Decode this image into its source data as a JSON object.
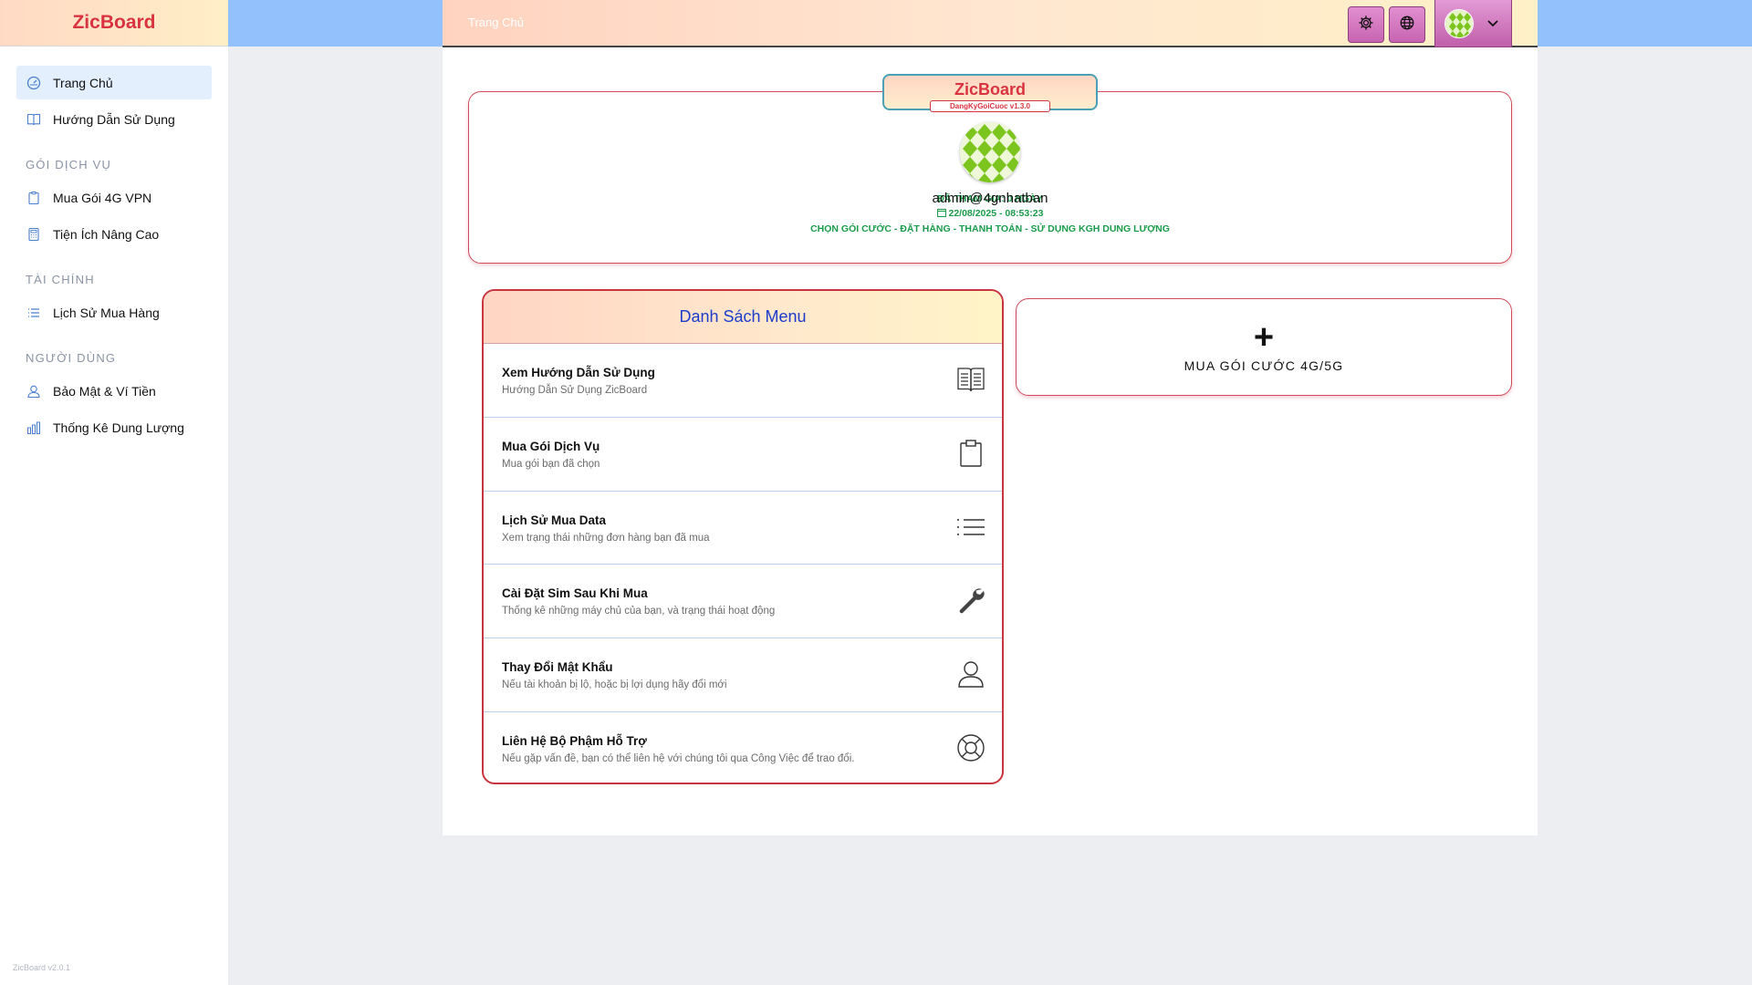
{
  "app": {
    "brand": "ZicBoard",
    "version": "ZicBoard v2.0.1"
  },
  "sidebar": {
    "items": [
      {
        "label": "Trang Chủ",
        "icon": "dashboard-icon",
        "active": true
      },
      {
        "label": "Hướng Dẫn Sử Dụng",
        "icon": "book-icon"
      }
    ],
    "sections": [
      {
        "title": "GÓI DỊCH VỤ",
        "items": [
          {
            "label": "Mua Gói 4G VPN",
            "icon": "clipboard-icon"
          },
          {
            "label": "Tiện Ích Nâng Cao",
            "icon": "calculator-icon"
          }
        ]
      },
      {
        "title": "TÀI CHÍNH",
        "items": [
          {
            "label": "Lịch Sử Mua Hàng",
            "icon": "list-icon"
          }
        ]
      },
      {
        "title": "NGƯỜI DÙNG",
        "items": [
          {
            "label": "Bảo Mật & Ví Tiền",
            "icon": "user-icon"
          },
          {
            "label": "Thống Kê Dung Lượng",
            "icon": "bar-chart-icon"
          }
        ]
      }
    ]
  },
  "header": {
    "title": "Trang Chủ",
    "settings_icon": "gear-icon",
    "language_icon": "globe-icon",
    "dropdown_icon": "chevron-down-icon"
  },
  "profile": {
    "title": "ZicBoard",
    "subtitle": "DangKyGoiCuoc v1.3.0",
    "username": "admin@4gnhatban",
    "joined": "ĐÃ THAM GIA: 0 NGÀY",
    "datetime": "22/08/2025 - 08:53:23",
    "steps": "CHỌN GÓI CƯỚC - ĐẶT HÀNG - THANH TOÁN - SỬ DỤNG KGH DUNG LƯỢNG"
  },
  "menu": {
    "title": "Danh Sách Menu",
    "items": [
      {
        "title": "Xem Hướng Dẫn Sử Dụng",
        "desc": "Hướng Dẫn Sử Dụng ZicBoard",
        "icon": "book-icon"
      },
      {
        "title": "Mua Gói Dịch Vụ",
        "desc": "Mua gói bạn đã chọn",
        "icon": "clipboard-icon"
      },
      {
        "title": "Lịch Sử Mua Data",
        "desc": "Xem trạng thái những đơn hàng bạn đã mua",
        "icon": "list-icon"
      },
      {
        "title": "Cài Đặt Sim Sau Khi Mua",
        "desc": "Thống kê những máy chủ của bạn, và trạng thái hoạt động",
        "icon": "wrench-icon"
      },
      {
        "title": "Thay Đổi Mật Khẩu",
        "desc": "Nếu tài khoản bị lộ, hoặc bị lợi dụng hãy đổi mới",
        "icon": "user-icon"
      },
      {
        "title": "Liên Hệ Bộ Phậm Hỗ Trợ",
        "desc": "Nếu gặp vấn đề, bạn có thể liên hệ với chúng tôi qua Công Việc để trao đổi.",
        "icon": "lifebuoy-icon"
      }
    ]
  },
  "buy": {
    "plus": "+",
    "label": "MUA GÓI CƯỚC 4G/5G"
  },
  "colors": {
    "brand_red": "#d9333f",
    "sidebar_active": "#e4effd",
    "header_blue": "#93c1fb",
    "accent_pink": "#c864b2",
    "menu_title_blue": "#1b3ccd",
    "info_green": "#1a9c4a"
  }
}
